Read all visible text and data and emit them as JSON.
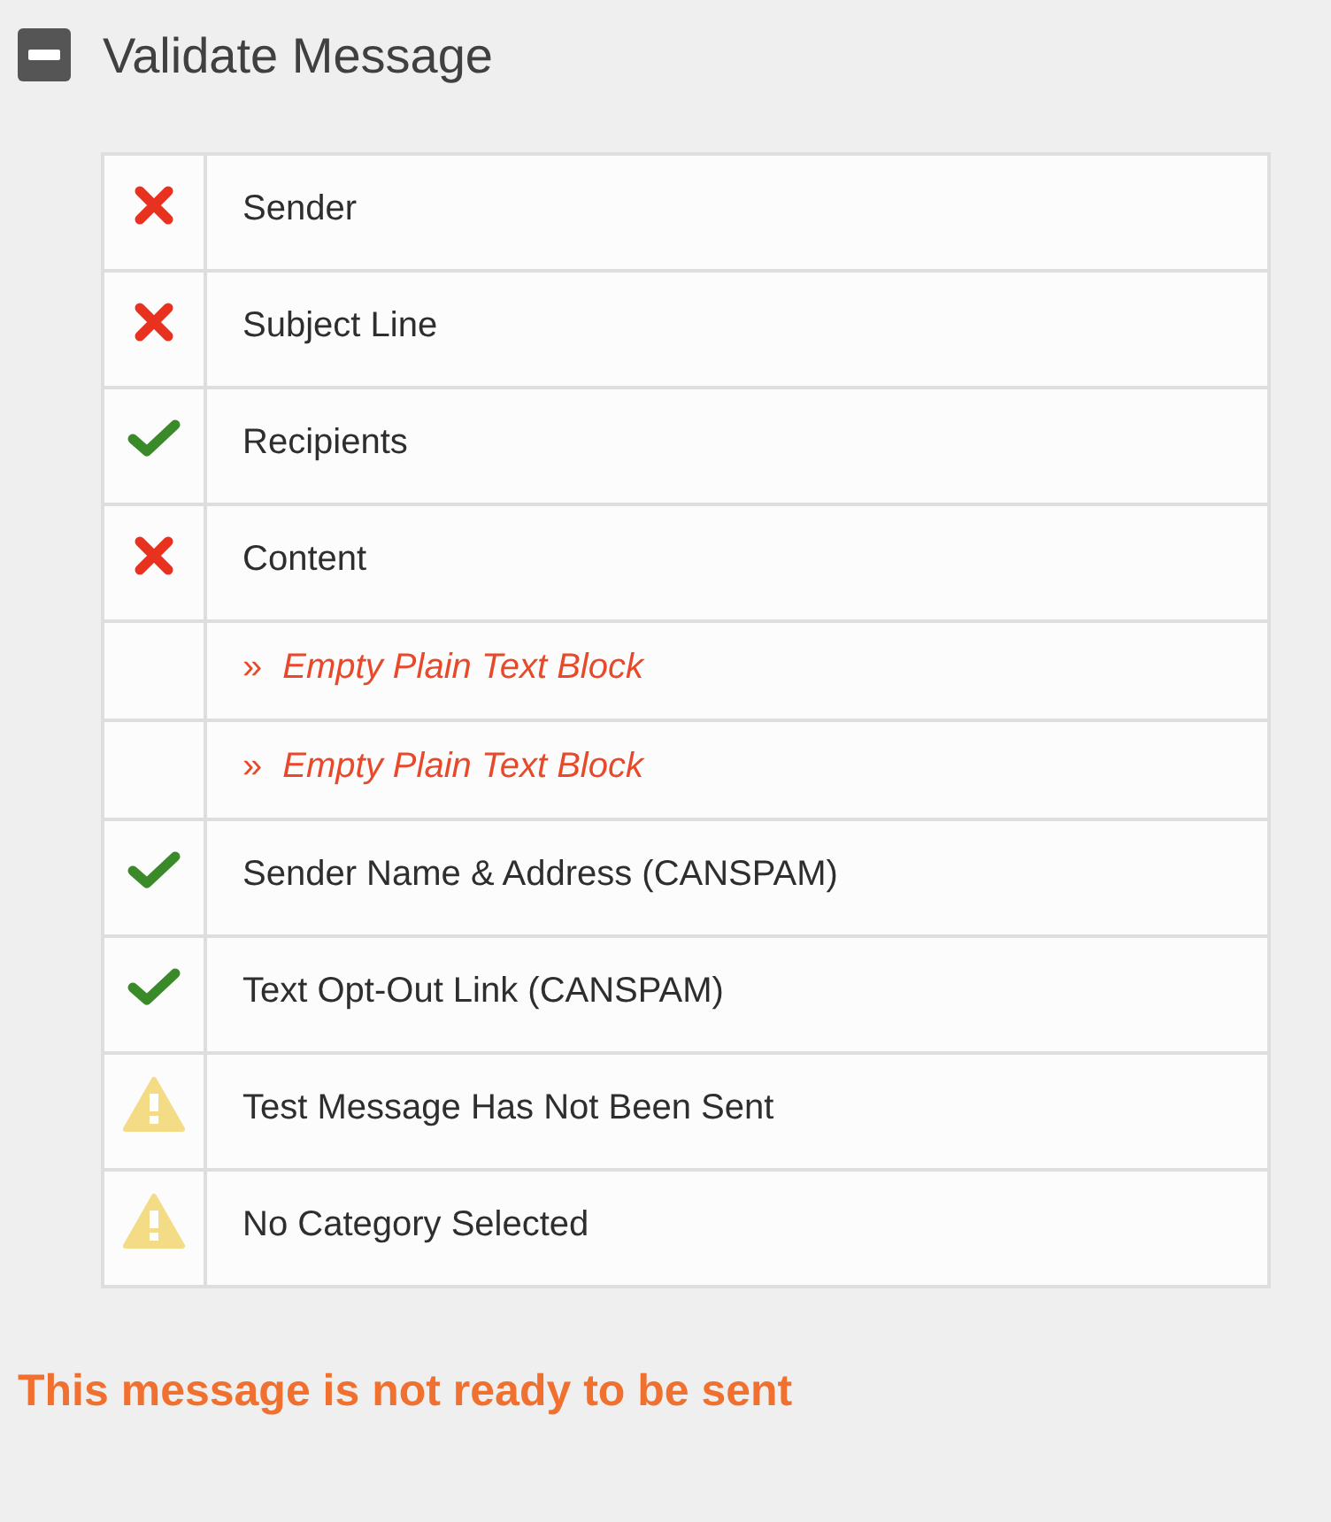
{
  "panel": {
    "title": "Validate Message",
    "expanded": true
  },
  "checks": [
    {
      "kind": "error",
      "label": "Sender"
    },
    {
      "kind": "error",
      "label": "Subject Line"
    },
    {
      "kind": "ok",
      "label": "Recipients"
    },
    {
      "kind": "error",
      "label": "Content"
    },
    {
      "kind": "detail",
      "marker": "»",
      "label": "Empty Plain Text Block"
    },
    {
      "kind": "detail",
      "marker": "»",
      "label": "Empty Plain Text Block"
    },
    {
      "kind": "ok",
      "label": "Sender Name & Address (CANSPAM)"
    },
    {
      "kind": "ok",
      "label": "Text Opt-Out Link (CANSPAM)"
    },
    {
      "kind": "warning",
      "label": "Test Message Has Not Been Sent"
    },
    {
      "kind": "warning",
      "label": "No Category Selected"
    }
  ],
  "status": "This message is not ready to be sent"
}
